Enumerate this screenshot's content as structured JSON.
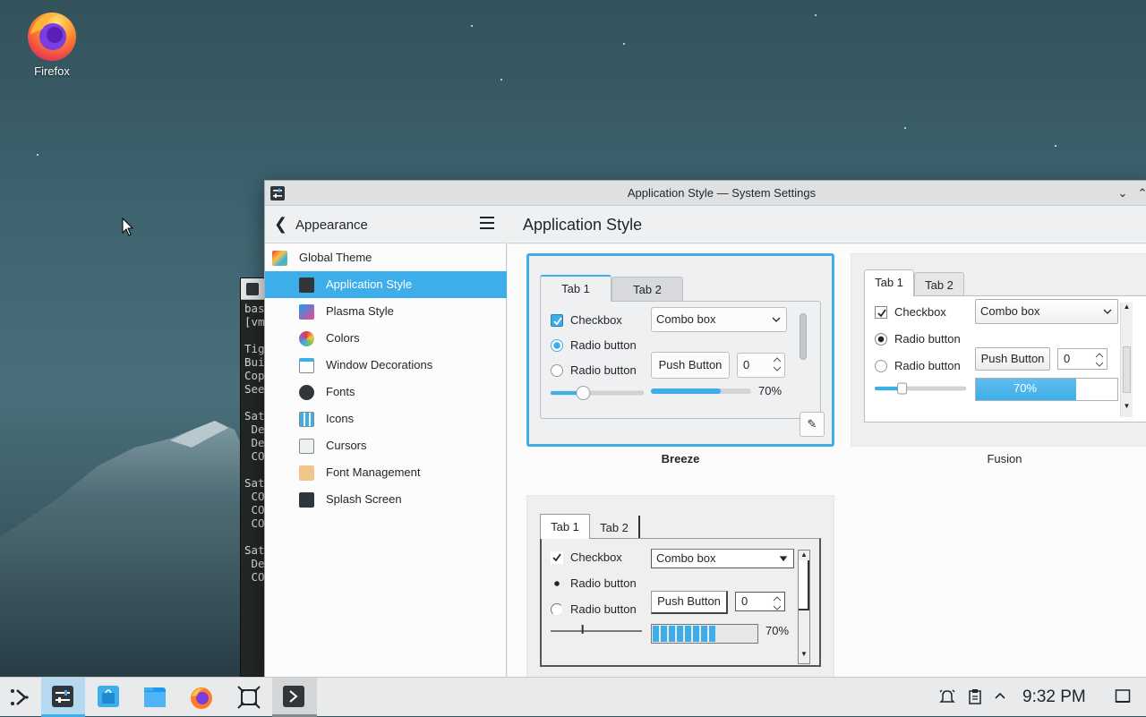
{
  "desktop": {
    "firefox_label": "Firefox"
  },
  "terminal": {
    "lines": [
      "bas",
      "[vm",
      "",
      "Tig",
      "Bui",
      "Cop",
      "See",
      "",
      "Sat",
      " De",
      " De",
      " CO",
      "",
      "Sat",
      " CO",
      " CO",
      " CO",
      "",
      "Sat",
      " De",
      " CO"
    ]
  },
  "window": {
    "title": "Application Style — System Settings",
    "min_glyph": "⌄",
    "max_glyph": "⌃"
  },
  "sidebar": {
    "back_glyph": "❮",
    "breadcrumb": "Appearance",
    "items": [
      {
        "label": "Global Theme",
        "icon": "global-theme-icon"
      },
      {
        "label": "Application Style",
        "icon": "application-style-icon",
        "selected": true
      },
      {
        "label": "Plasma Style",
        "icon": "plasma-style-icon"
      },
      {
        "label": "Colors",
        "icon": "colors-icon"
      },
      {
        "label": "Window Decorations",
        "icon": "window-decorations-icon"
      },
      {
        "label": "Fonts",
        "icon": "fonts-icon"
      },
      {
        "label": "Icons",
        "icon": "icons-icon"
      },
      {
        "label": "Cursors",
        "icon": "cursors-icon"
      },
      {
        "label": "Font Management",
        "icon": "font-management-icon"
      },
      {
        "label": "Splash Screen",
        "icon": "splash-screen-icon"
      }
    ]
  },
  "content": {
    "title": "Application Style"
  },
  "styles": [
    {
      "name": "Breeze",
      "selected": true,
      "tab1": "Tab 1",
      "tab2": "Tab 2",
      "checkbox": "Checkbox",
      "radio1": "Radio button",
      "radio2": "Radio button",
      "combo": "Combo box",
      "push": "Push Button",
      "spin": "0",
      "slider_level": 0.35,
      "progress": 0.7,
      "progress_text": "70%",
      "edit_glyph": "✎"
    },
    {
      "name": "Fusion",
      "tab1": "Tab 1",
      "tab2": "Tab 2",
      "checkbox": "Checkbox",
      "radio1": "Radio button",
      "radio2": "Radio button",
      "combo": "Combo box",
      "push": "Push Button",
      "spin": "0",
      "slider_level": 0.3,
      "progress": 0.7,
      "progress_text": "70%"
    },
    {
      "name": "",
      "tab1": "Tab 1",
      "tab2": "Tab 2",
      "checkbox": "Checkbox",
      "radio1": "Radio button",
      "radio2": "Radio button",
      "combo": "Combo box",
      "push": "Push Button",
      "spin": "0",
      "slider_level": 0.35,
      "progress": 0.7,
      "progress_text": "70%"
    }
  ],
  "taskbar": {
    "clock": "9:32 PM",
    "apps": [
      "app-launcher-icon",
      "system-settings-icon",
      "discover-icon",
      "dolphin-icon",
      "firefox-icon",
      "spectacle-icon",
      "konsole-icon"
    ]
  },
  "colors": {
    "accent": "#3daee9",
    "selection_text": "#ffffff"
  }
}
